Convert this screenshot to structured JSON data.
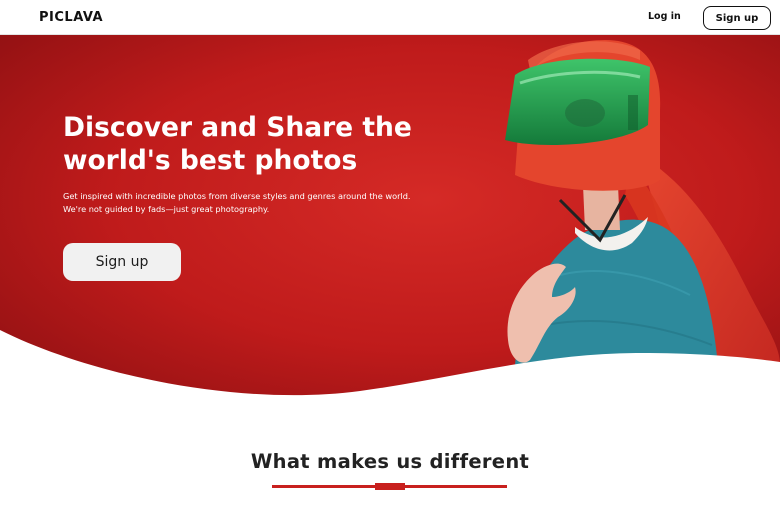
{
  "header": {
    "brand": "PICLAVA",
    "login_label": "Log in",
    "signup_label": "Sign up"
  },
  "hero": {
    "headline_lines": [
      "Discover and Share the",
      "world's best photos"
    ],
    "subtext_lines": [
      "Get inspired with incredible photos from diverse styles and genres around the world.",
      "We're not guided by fads—just great photography."
    ],
    "signup_label": "Sign up",
    "image": "woman-in-red-helmet-photo"
  },
  "section": {
    "title": "What makes us different"
  },
  "colors": {
    "accent": "#c8201e",
    "hero_red": "#c41c1c",
    "button_bg": "#f1f1f1",
    "text_dark": "#111111"
  }
}
